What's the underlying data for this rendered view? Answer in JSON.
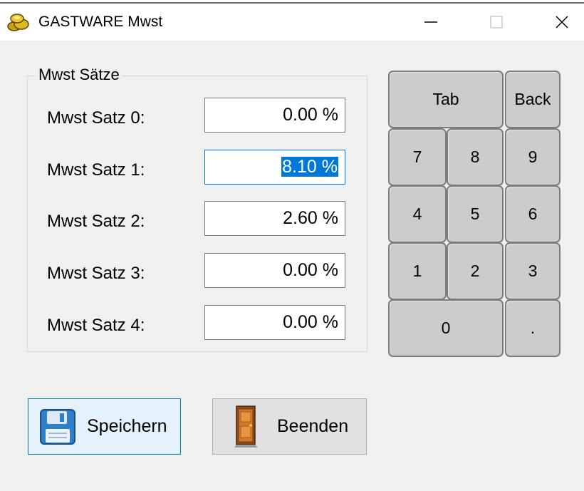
{
  "window": {
    "title": "GASTWARE Mwst",
    "minimize_glyph": "—",
    "maximize_glyph": "☐",
    "close_glyph": "✕"
  },
  "group": {
    "label": "Mwst Sätze"
  },
  "vat_rates": [
    {
      "label": "Mwst Satz 0:",
      "value": "0.00 %"
    },
    {
      "label": "Mwst Satz 1:",
      "value": "8.10 %"
    },
    {
      "label": "Mwst Satz 2:",
      "value": "2.60 %"
    },
    {
      "label": "Mwst Satz 3:",
      "value": "0.00 %"
    },
    {
      "label": "Mwst Satz 4:",
      "value": "0.00 %"
    }
  ],
  "focused_rate_index": 1,
  "keypad": {
    "tab": "Tab",
    "back": "Back",
    "k7": "7",
    "k8": "8",
    "k9": "9",
    "k4": "4",
    "k5": "5",
    "k6": "6",
    "k1": "1",
    "k2": "2",
    "k3": "3",
    "k0": "0",
    "dot": "."
  },
  "buttons": {
    "save_label": "Speichern",
    "exit_label": "Beenden"
  },
  "icons": {
    "app": "app-coins-icon",
    "save": "floppy-disk-icon",
    "exit": "door-icon"
  },
  "colors": {
    "accent": "#0078d7",
    "selection": "#0078d7",
    "key_face": "#cccccc",
    "window_bg": "#f0f0f0"
  }
}
